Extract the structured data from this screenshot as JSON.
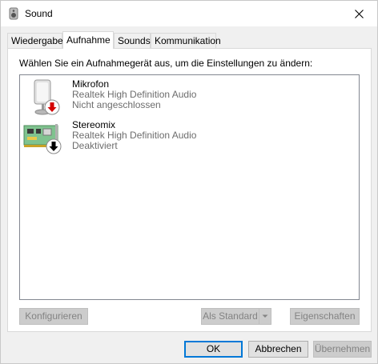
{
  "window": {
    "title": "Sound",
    "close_glyph": "✕"
  },
  "tabs": [
    {
      "label": "Wiedergabe"
    },
    {
      "label": "Aufnahme"
    },
    {
      "label": "Sounds"
    },
    {
      "label": "Kommunikation"
    }
  ],
  "panel": {
    "instruction": "Wählen Sie ein Aufnahmegerät aus, um die Einstellungen zu ändern:",
    "devices": [
      {
        "name": "Mikrofon",
        "driver": "Realtek High Definition Audio",
        "status": "Nicht angeschlossen",
        "icon": "microphone-icon",
        "badge": "disconnected-arrow-icon",
        "badge_color": "#d40000"
      },
      {
        "name": "Stereomix",
        "driver": "Realtek High Definition Audio",
        "status": "Deaktiviert",
        "icon": "sound-card-icon",
        "badge": "disabled-arrow-icon",
        "badge_color": "#000000"
      }
    ],
    "configure_label": "Konfigurieren",
    "set_default_label": "Als Standard",
    "properties_label": "Eigenschaften"
  },
  "footer": {
    "ok_label": "OK",
    "cancel_label": "Abbrechen",
    "apply_label": "Übernehmen"
  }
}
